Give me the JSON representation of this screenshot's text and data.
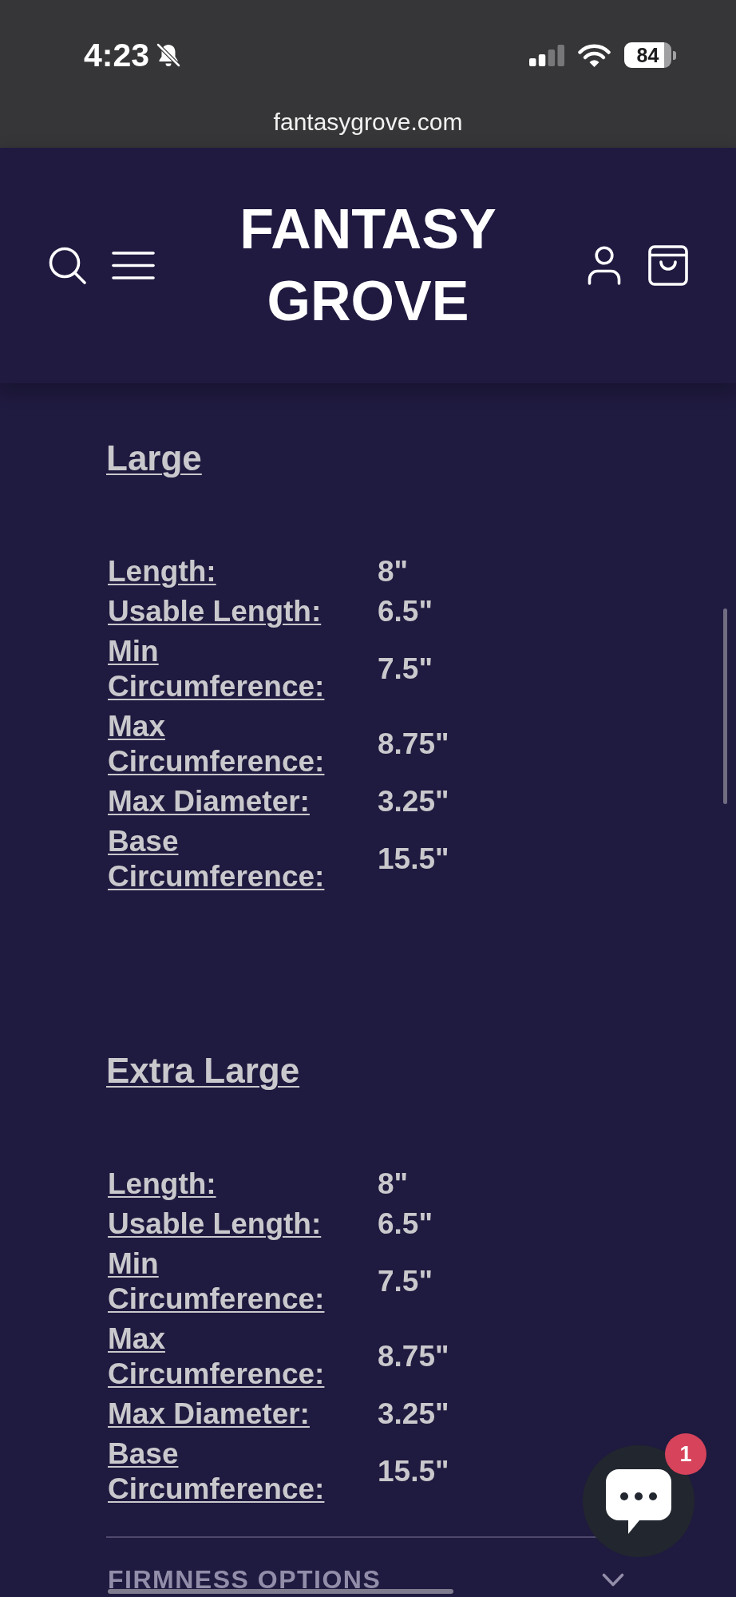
{
  "status_bar": {
    "time": "4:23",
    "battery": "84",
    "url": "fantasygrove.com"
  },
  "header": {
    "logo": "FANTASY GROVE"
  },
  "sections": [
    {
      "title": "Large",
      "specs": [
        {
          "label": "Length:",
          "value": "8\""
        },
        {
          "label": "Usable Length:",
          "value": "6.5\""
        },
        {
          "label": "Min Circumference:",
          "value": "7.5\""
        },
        {
          "label": "Max Circumference:",
          "value": "8.75\""
        },
        {
          "label": "Max Diameter:",
          "value": "3.25\""
        },
        {
          "label": "Base Circumference:",
          "value": "15.5\""
        }
      ]
    },
    {
      "title": "Extra Large",
      "specs": [
        {
          "label": "Length:",
          "value": "8\""
        },
        {
          "label": "Usable Length:",
          "value": "6.5\""
        },
        {
          "label": "Min Circumference:",
          "value": "7.5\""
        },
        {
          "label": "Max Circumference:",
          "value": "8.75\""
        },
        {
          "label": "Max Diameter:",
          "value": "3.25\""
        },
        {
          "label": "Base Circumference:",
          "value": "15.5\""
        }
      ]
    }
  ],
  "accordion": {
    "title": "FIRMNESS OPTIONS",
    "expanded": false
  },
  "chat": {
    "badge": "1"
  }
}
